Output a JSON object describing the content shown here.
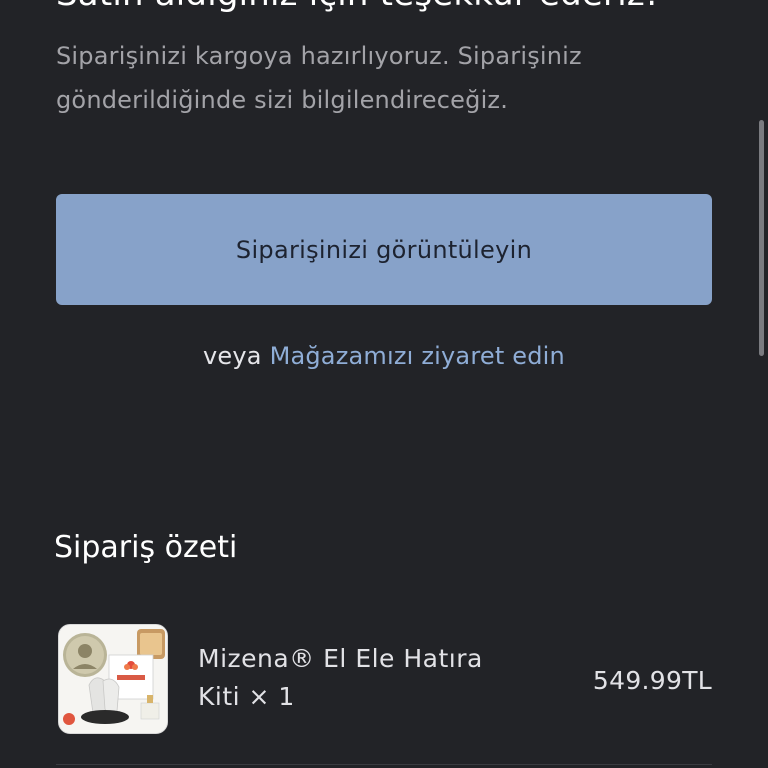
{
  "confirmation": {
    "heading": "Satın aldığınız için teşekkür ederiz!",
    "message": "Siparişinizi kargoya hazırlıyoruz. Siparişiniz gönderildiğinde sizi bilgilendireceğiz."
  },
  "actions": {
    "view_order_label": "Siparişinizi görüntüleyin",
    "or_text": "veya",
    "visit_store_label": "Mağazamızı ziyaret edin"
  },
  "summary": {
    "title": "Sipariş özeti",
    "items": [
      {
        "name": "Mizena® El Ele Hatıra Kiti × 1",
        "price": "549.99TL",
        "thumbnail_brand": "Mizena"
      }
    ]
  },
  "colors": {
    "background": "#222327",
    "button": "#87a2c9",
    "link": "#8fadd6"
  }
}
